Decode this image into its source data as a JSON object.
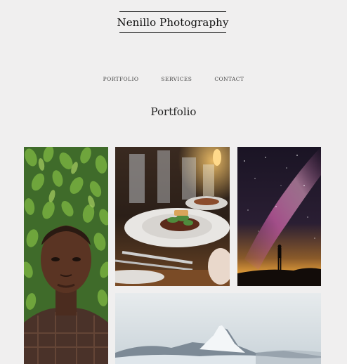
{
  "site": {
    "logo": "Nenillo Photography"
  },
  "nav": [
    {
      "label": "PORTFOLIO"
    },
    {
      "label": "SERVICES"
    },
    {
      "label": "CONTACT"
    }
  ],
  "page": {
    "title": "Portfolio"
  },
  "gallery": [
    {
      "subject": "portrait of man framed by green leaves"
    },
    {
      "subject": "plated restaurant dish on dining table"
    },
    {
      "subject": "milky way night sky with silhouette"
    },
    {
      "subject": "snowy mountain peak"
    }
  ],
  "colors": {
    "background": "#f0efef",
    "text": "#222222"
  }
}
